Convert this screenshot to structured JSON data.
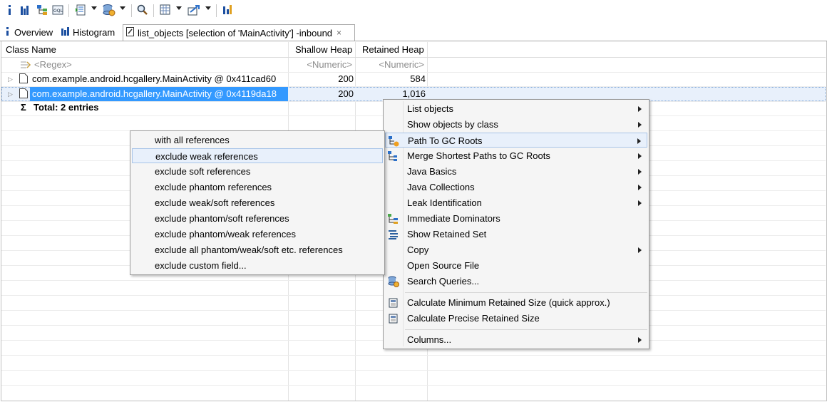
{
  "toolbar": {
    "icons": [
      "info-icon",
      "histogram-icon",
      "dominator-tree-icon",
      "oql-icon",
      "thread-overview-icon",
      "query-browser-icon",
      "search-icon",
      "heap-dump-overview-icon",
      "export-icon",
      "leak-suspects-icon"
    ]
  },
  "tabs": [
    {
      "label": "Overview",
      "icon": "info-icon"
    },
    {
      "label": "Histogram",
      "icon": "histogram-icon"
    },
    {
      "label": "list_objects [selection of 'MainActivity'] -inbound",
      "icon": "list-objects-icon",
      "close": "×"
    }
  ],
  "table": {
    "columns": [
      "Class Name",
      "Shallow Heap",
      "Retained Heap"
    ],
    "filter": {
      "name": "<Regex>",
      "shallow": "<Numeric>",
      "retained": "<Numeric>"
    },
    "rows": [
      {
        "name": "com.example.android.hcgallery.MainActivity @ 0x411cad60",
        "shallow": "200",
        "retained": "584",
        "selected": false
      },
      {
        "name": "com.example.android.hcgallery.MainActivity @ 0x4119da18",
        "shallow": "200",
        "retained": "1,016",
        "selected": true
      }
    ],
    "total": {
      "symbol": "Σ",
      "label": "Total: 2 entries"
    }
  },
  "context_menu": {
    "items": [
      {
        "label": "List objects",
        "submenu": true
      },
      {
        "label": "Show objects by class",
        "submenu": true
      },
      {
        "label": "Path To GC Roots",
        "submenu": true,
        "highlighted": true
      },
      {
        "label": "Merge Shortest Paths to GC Roots",
        "submenu": true
      },
      {
        "label": "Java Basics",
        "submenu": true
      },
      {
        "label": "Java Collections",
        "submenu": true
      },
      {
        "label": "Leak Identification",
        "submenu": true
      },
      {
        "label": "Immediate Dominators",
        "submenu": false
      },
      {
        "label": "Show Retained Set",
        "submenu": false
      },
      {
        "label": "Copy",
        "submenu": true
      },
      {
        "label": "Open Source File",
        "submenu": false
      },
      {
        "label": "Search Queries...",
        "submenu": false
      },
      {
        "label": "Calculate Minimum Retained Size (quick approx.)",
        "submenu": false
      },
      {
        "label": "Calculate Precise Retained Size",
        "submenu": false
      },
      {
        "label": "Columns...",
        "submenu": true
      }
    ]
  },
  "submenu": {
    "items": [
      {
        "label": "with all references"
      },
      {
        "label": "exclude weak references",
        "highlighted": true
      },
      {
        "label": "exclude soft references"
      },
      {
        "label": "exclude phantom references"
      },
      {
        "label": "exclude weak/soft references"
      },
      {
        "label": "exclude phantom/soft references"
      },
      {
        "label": "exclude phantom/weak references"
      },
      {
        "label": "exclude all phantom/weak/soft etc. references"
      },
      {
        "label": "exclude custom field..."
      }
    ]
  },
  "colors": {
    "selection": "#3399ff",
    "menu_bg": "#f5f5f5",
    "menu_highlight": "#e8f0fb"
  }
}
